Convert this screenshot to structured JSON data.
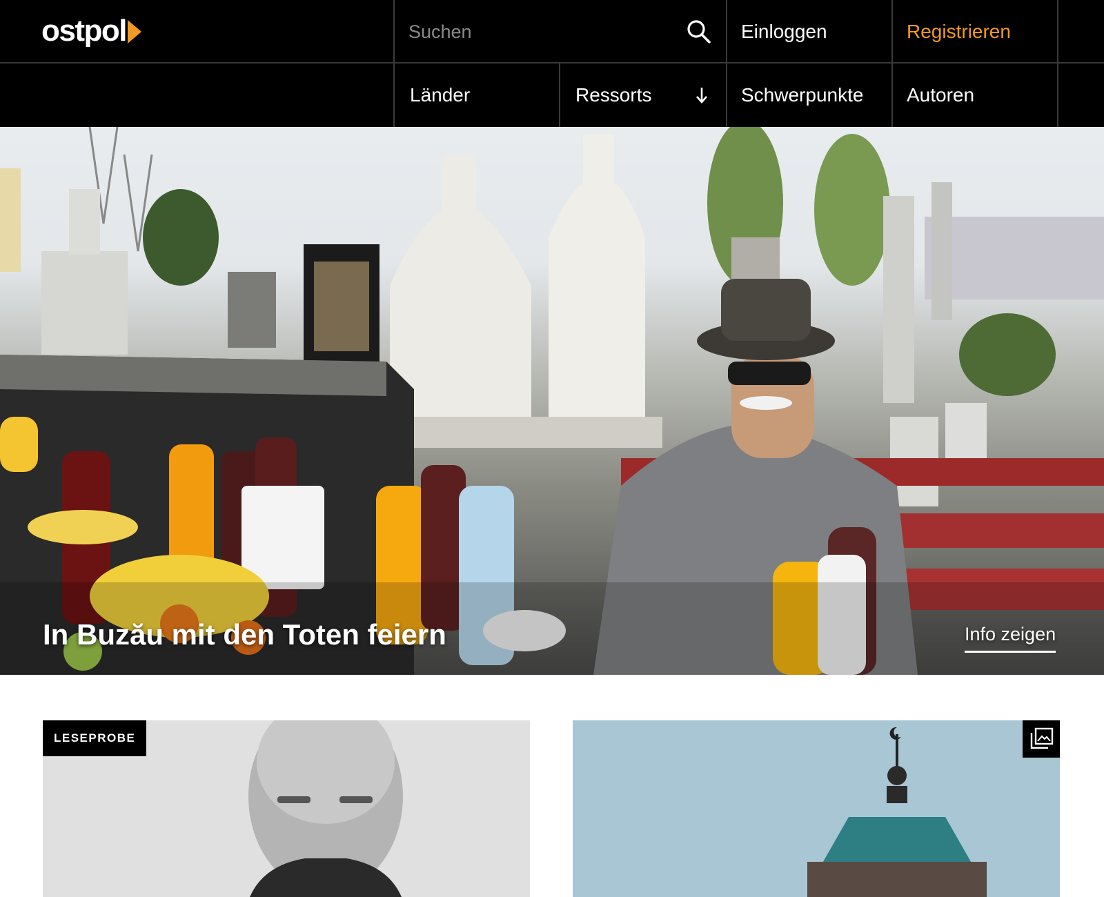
{
  "brand": {
    "logo_text": "ostpol",
    "accent_color": "#f29a1f"
  },
  "header": {
    "search_placeholder": "Suchen",
    "login_label": "Einloggen",
    "register_label": "Registrieren"
  },
  "nav": {
    "items": [
      {
        "label": "Länder"
      },
      {
        "label": "Ressorts",
        "icon": "arrow-down-icon"
      },
      {
        "label": "Schwerpunkte"
      },
      {
        "label": "Autoren"
      }
    ]
  },
  "hero": {
    "title": "In Buzău mit den Toten feiern",
    "info_label": "Info zeigen"
  },
  "cards": [
    {
      "badge": "LESEPROBE"
    },
    {
      "icon": "gallery-icon"
    }
  ]
}
